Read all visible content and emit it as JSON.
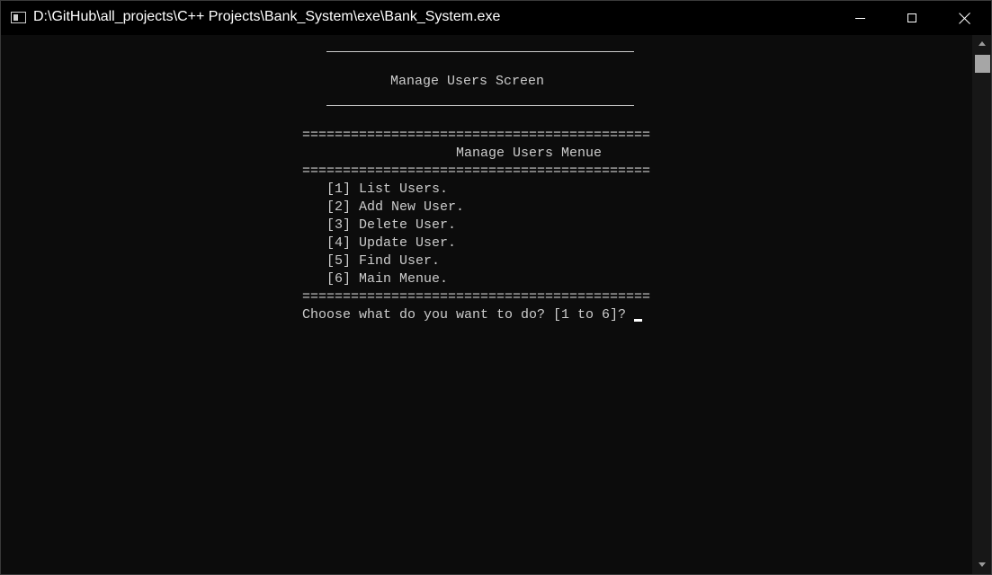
{
  "window": {
    "title": "D:\\GitHub\\all_projects\\C++ Projects\\Bank_System\\exe\\Bank_System.exe"
  },
  "console": {
    "screen_title": "Manage Users Screen",
    "separator": "===========================================",
    "menu_title": "Manage Users Menue",
    "menu_items": [
      "[1] List Users.",
      "[2] Add New User.",
      "[3] Delete User.",
      "[4] Update User.",
      "[5] Find User.",
      "[6] Main Menue."
    ],
    "prompt": "Choose what do you want to do? [1 to 6]?"
  },
  "colors": {
    "background": "#0c0c0c",
    "text": "#cccccc",
    "titlebar": "#000000"
  },
  "icons": {
    "app": "console-window-icon",
    "minimize": "minimize-icon",
    "maximize": "maximize-icon",
    "close": "close-icon"
  }
}
